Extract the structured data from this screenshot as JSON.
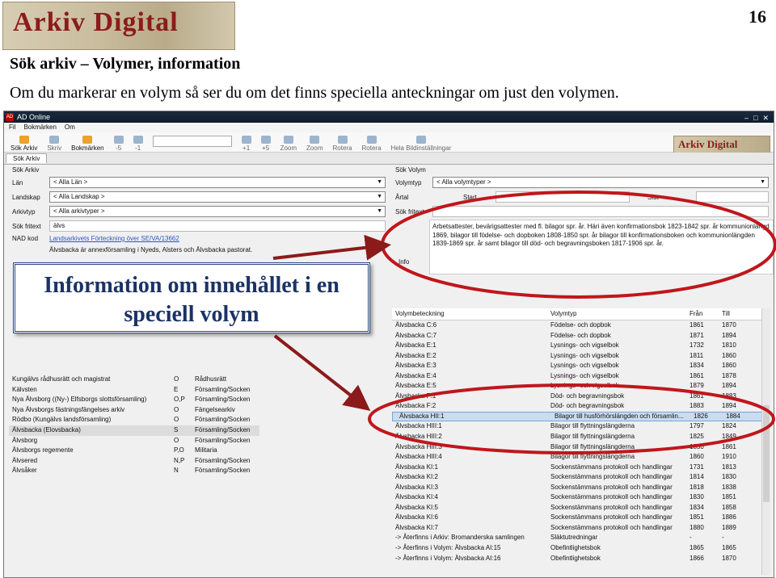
{
  "slide": {
    "logo": "Arkiv Digital",
    "page_number": "16",
    "heading": "Sök arkiv – Volymer, information",
    "intro": "Om du markerar en volym så ser du om det finns speciella anteckningar om just den volymen."
  },
  "window": {
    "title": "AD Online",
    "menu": [
      "Fil",
      "Bokmärken",
      "Om"
    ],
    "toolbar": [
      "Sök Arkiv",
      "Skriv",
      "Bokmärken",
      "-5",
      "-1",
      "+1",
      "+5",
      "Zoom",
      "Zoom",
      "Rotera",
      "Rotera",
      "Hela Bildinställningar"
    ],
    "tab": "Sök Arkiv"
  },
  "left": {
    "section": "Sök Arkiv",
    "fields": [
      {
        "label": "Län",
        "value": "< Alla Län >"
      },
      {
        "label": "Landskap",
        "value": "< Alla Landskap >"
      },
      {
        "label": "Arkivtyp",
        "value": "< Alla arkivtyper >"
      }
    ],
    "fritext_label": "Sök fritext",
    "fritext_value": "älvs",
    "nad_label": "NAD kod",
    "nad_link": "Landsarkivets Förteckning över SE/VA/13662",
    "description": "Älvsbacka är annexförsamling i Nyeds, Alsters och Älvsbacka pastorat.",
    "archives": [
      {
        "name": "Kungälvs rådhusrätt och magistrat",
        "code": "O",
        "type": "Rådhusrätt"
      },
      {
        "name": "Kälvsten",
        "code": "E",
        "type": "Församling/Socken"
      },
      {
        "name": "Nya Älvsborg ((Ny-) Elfsborgs slottsförsamling)",
        "code": "O,P",
        "type": "Församling/Socken"
      },
      {
        "name": "Nya Älvsborgs fästningsfängelses arkiv",
        "code": "O",
        "type": "Fängelsearkiv"
      },
      {
        "name": "Rödbo (Kungälvs landsförsamling)",
        "code": "O",
        "type": "Församling/Socken"
      },
      {
        "name": "Älvsbacka (Elovsbacka)",
        "code": "S",
        "type": "Församling/Socken"
      },
      {
        "name": "Älvsborg",
        "code": "O",
        "type": "Församling/Socken"
      },
      {
        "name": "Älvsborgs regemente",
        "code": "P,O",
        "type": "Militaria"
      },
      {
        "name": "Älvsered",
        "code": "N,P",
        "type": "Församling/Socken"
      },
      {
        "name": "Älvsåker",
        "code": "N",
        "type": "Församling/Socken"
      }
    ],
    "selected_archive_index": 5
  },
  "right": {
    "section": "Sök Volym",
    "volymtyp_label": "Volymtyp",
    "volymtyp_value": "< Alla volymtyper >",
    "artal_label": "Årtal",
    "start_label": "Start",
    "slut_label": "Slut",
    "fritext_label": "Sök fritext",
    "info_text": "Arbetsattester, bevärigsattester med fl. bilagor spr. år. Häri även konfirmationsbok 1823-1842 spr. år kommunionlängd 1869, bilagor till födelse- och dopboken 1808-1850 spr. år bilagor till konfirmationsboken och kommunionlängden 1839-1869 spr. år samt bilagor till död- och begravningsboken 1817-1906 spr. år.",
    "info_label": "Info",
    "columns": [
      "Volymbeteckning",
      "Volymtyp",
      "Från",
      "Till"
    ],
    "volumes": [
      [
        "Älvsbacka C:6",
        "Födelse- och dopbok",
        "1861",
        "1870"
      ],
      [
        "Älvsbacka C:7",
        "Födelse- och dopbok",
        "1871",
        "1894"
      ],
      [
        "Älvsbacka E:1",
        "Lysnings- och vigselbok",
        "1732",
        "1810"
      ],
      [
        "Älvsbacka E:2",
        "Lysnings- och vigselbok",
        "1811",
        "1860"
      ],
      [
        "Älvsbacka E:3",
        "Lysnings- och vigselbok",
        "1834",
        "1860"
      ],
      [
        "Älvsbacka E:4",
        "Lysnings- och vigselbok",
        "1861",
        "1878"
      ],
      [
        "Älvsbacka E:5",
        "Lysnings- och vigselbok",
        "1879",
        "1894"
      ],
      [
        "Älvsbacka F:1",
        "Död- och begravningsbok",
        "1861",
        "1883"
      ],
      [
        "Älvsbacka F:2",
        "Död- och begravningsbok",
        "1883",
        "1894"
      ],
      [
        "Älvsbacka HII:1",
        "Bilagor till husförhörslängden och församlin...",
        "1826",
        "1884"
      ],
      [
        "Älvsbacka HIII:1",
        "Bilagor till flyttningslängderna",
        "1797",
        "1824"
      ],
      [
        "Älvsbacka HIII:2",
        "Bilagor till flyttningslängderna",
        "1825",
        "1849"
      ],
      [
        "Älvsbacka HIII:3",
        "Bilagor till flyttningslängderna",
        "1850",
        "1861"
      ],
      [
        "Älvsbacka HIII:4",
        "Bilagor till flyttningslängderna",
        "1860",
        "1910"
      ],
      [
        "Älvsbacka KI:1",
        "Sockenstämmans protokoll och handlingar",
        "1731",
        "1813"
      ],
      [
        "Älvsbacka KI:2",
        "Sockenstämmans protokoll och handlingar",
        "1814",
        "1830"
      ],
      [
        "Älvsbacka KI:3",
        "Sockenstämmans protokoll och handlingar",
        "1818",
        "1838"
      ],
      [
        "Älvsbacka KI:4",
        "Sockenstämmans protokoll och handlingar",
        "1830",
        "1851"
      ],
      [
        "Älvsbacka KI:5",
        "Sockenstämmans protokoll och handlingar",
        "1834",
        "1858"
      ],
      [
        "Älvsbacka KI:6",
        "Sockenstämmans protokoll och handlingar",
        "1851",
        "1886"
      ],
      [
        "Älvsbacka KI:7",
        "Sockenstämmans protokoll och handlingar",
        "1880",
        "1889"
      ],
      [
        "-> Återfinns i Arkiv: Bromanderska samlingen",
        "Släktutredningar",
        "-",
        "-"
      ],
      [
        "-> Återfinns i Volym: Älvsbacka AI:15",
        "Obefintlighetsbok",
        "1865",
        "1865"
      ],
      [
        "-> Återfinns i Volym: Älvsbacka AI:16",
        "Obefintlighetsbok",
        "1866",
        "1870"
      ]
    ],
    "selected_volume_index": 9
  },
  "callout": {
    "line1": "Information om innehållet i en",
    "line2": "speciell volym"
  },
  "colors": {
    "arrow": "#8b1a1a",
    "ellipse": "#c0161c",
    "callout_text": "#1b3365",
    "logo_text": "#8c1b1b"
  }
}
